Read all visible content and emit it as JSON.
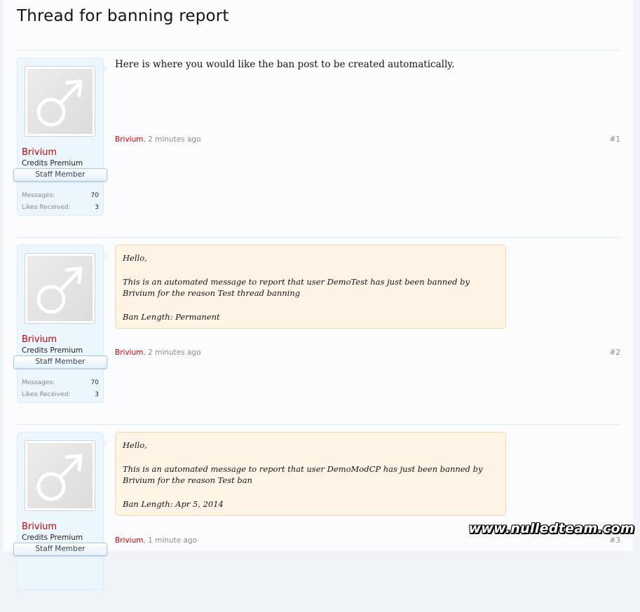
{
  "page": {
    "title": "Thread for banning report"
  },
  "icons": {
    "avatar": "male-symbol-icon"
  },
  "colors": {
    "username": "#cc0000",
    "quote_background": "#fff4e5",
    "user_block_background": "#ebf6fd"
  },
  "posts": [
    {
      "author": "Brivium",
      "user_title": "Credits Premium",
      "banner": "Staff Member",
      "stats": [
        {
          "label": "Messages:",
          "value": "70"
        },
        {
          "label": "Likes Received:",
          "value": "3"
        }
      ],
      "message": "Here is where you would like the ban post to be created automatically.",
      "meta_author": "Brivium",
      "meta_date": ", 2 minutes ago",
      "number": "#1"
    },
    {
      "author": "Brivium",
      "user_title": "Credits Premium",
      "banner": "Staff Member",
      "stats": [
        {
          "label": "Messages:",
          "value": "70"
        },
        {
          "label": "Likes Received:",
          "value": "3"
        }
      ],
      "quote": {
        "greeting": "Hello,",
        "body": "This is an automated message to report that user DemoTest has just been banned by Brivium for the reason Test thread banning",
        "length": "Ban Length: Permanent"
      },
      "meta_author": "Brivium",
      "meta_date": ", 2 minutes ago",
      "number": "#2"
    },
    {
      "author": "Brivium",
      "user_title": "Credits Premium",
      "banner": "Staff Member",
      "quote": {
        "greeting": "Hello,",
        "body": "This is an automated message to report that user DemoModCP has just been banned by Brivium for the reason Test ban",
        "length": "Ban Length: Apr 5, 2014"
      },
      "meta_author": "Brivium",
      "meta_date": ", 1 minute ago",
      "number": "#3"
    }
  ],
  "watermark": "www.nulledteam.com"
}
